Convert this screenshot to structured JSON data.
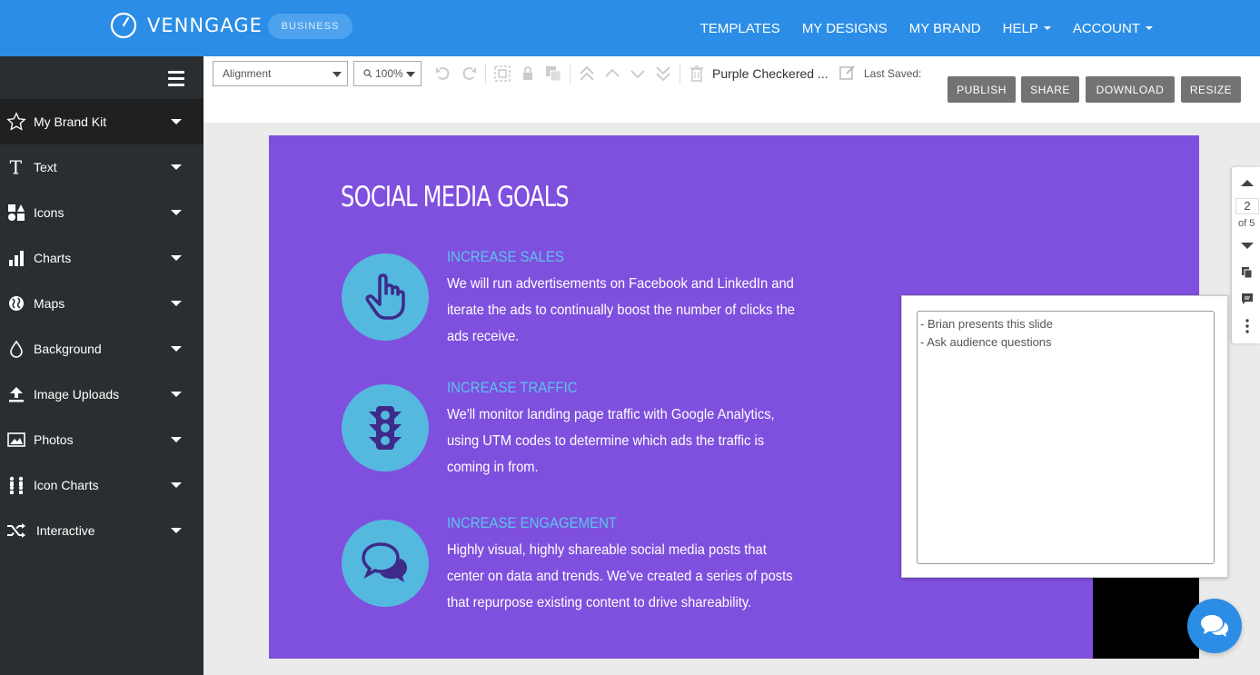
{
  "app": {
    "brand": "VENNGAGE",
    "plan_badge": "BUSINESS"
  },
  "topnav": [
    {
      "label": "TEMPLATES"
    },
    {
      "label": "MY DESIGNS"
    },
    {
      "label": "MY BRAND"
    },
    {
      "label": "HELP"
    },
    {
      "label": "ACCOUNT"
    }
  ],
  "sidebar": {
    "items": [
      {
        "label": "My Brand Kit",
        "icon": "star-icon"
      },
      {
        "label": "Text",
        "icon": "text-icon"
      },
      {
        "label": "Icons",
        "icon": "shapes-icon"
      },
      {
        "label": "Charts",
        "icon": "bar-chart-icon"
      },
      {
        "label": "Maps",
        "icon": "globe-icon"
      },
      {
        "label": "Background",
        "icon": "droplet-icon"
      },
      {
        "label": "Image Uploads",
        "icon": "upload-icon"
      },
      {
        "label": "Photos",
        "icon": "photo-icon"
      },
      {
        "label": "Icon Charts",
        "icon": "people-icon"
      },
      {
        "label": "Interactive",
        "icon": "shuffle-icon"
      }
    ]
  },
  "toolbar": {
    "alignment_value": "Alignment",
    "zoom_value": "100%",
    "document_title": "Purple Checkered ...",
    "last_saved": "Last Saved:",
    "publish": "PUBLISH",
    "share": "SHARE",
    "download": "DOWNLOAD",
    "resize": "RESIZE"
  },
  "slide": {
    "title": "SOCIAL MEDIA GOALS",
    "background_color": "#7f4fde",
    "goals": [
      {
        "heading": "INCREASE SALES",
        "text": "We will run advertisements on Facebook and LinkedIn and iterate the ads to continually boost the number of clicks the ads receive.",
        "icon": "pointer-hand-icon"
      },
      {
        "heading": "INCREASE TRAFFIC",
        "text": "We'll monitor landing page traffic with Google Analytics, using UTM codes to determine which ads the traffic is coming in from.",
        "icon": "traffic-light-icon"
      },
      {
        "heading": "INCREASE ENGAGEMENT",
        "text": "Highly visual, highly shareable social media posts that center on data and trends. We've created a series of posts that repurpose existing content to drive shareability.",
        "icon": "chat-bubbles-icon"
      }
    ]
  },
  "notes": {
    "text": "- Brian presents this slide\n- Ask audience questions"
  },
  "pagenav": {
    "current": "2",
    "of": "of 5"
  }
}
